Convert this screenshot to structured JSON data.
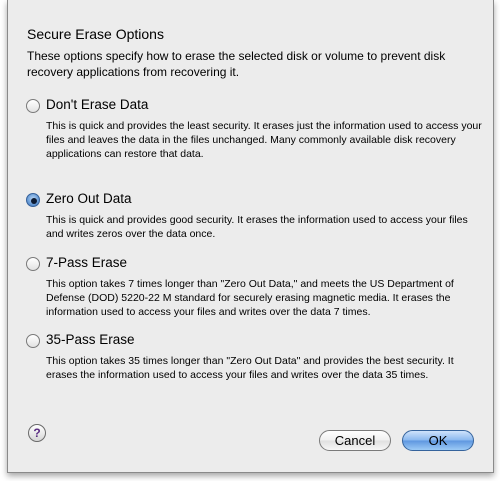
{
  "dialog": {
    "title": "Secure Erase Options",
    "intro": "These options specify how to erase the selected disk or volume to prevent disk recovery applications from recovering it."
  },
  "options": [
    {
      "label": "Don't Erase Data",
      "selected": false,
      "description": "This is quick and provides the least security. It erases just the information used to access your files and leaves the data in the files unchanged. Many commonly available disk recovery applications can restore that data."
    },
    {
      "label": "Zero Out Data",
      "selected": true,
      "description": "This is quick and provides good security. It erases the information used to access your files and writes zeros over the data once."
    },
    {
      "label": "7-Pass Erase",
      "selected": false,
      "description": "This option takes 7 times longer than \"Zero Out Data,\" and meets the US Department of Defense (DOD) 5220-22 M standard for securely erasing magnetic media. It erases the information used to access your files and writes over the data 7 times."
    },
    {
      "label": "35-Pass Erase",
      "selected": false,
      "description": "This option takes 35 times longer than \"Zero Out Data\" and provides the best security. It erases the information used to access your files and writes over the data 35 times."
    }
  ],
  "buttons": {
    "help": "?",
    "cancel": "Cancel",
    "ok": "OK"
  },
  "colors": {
    "sheet_background": "#ececec",
    "default_button": "#6fa6e8"
  }
}
